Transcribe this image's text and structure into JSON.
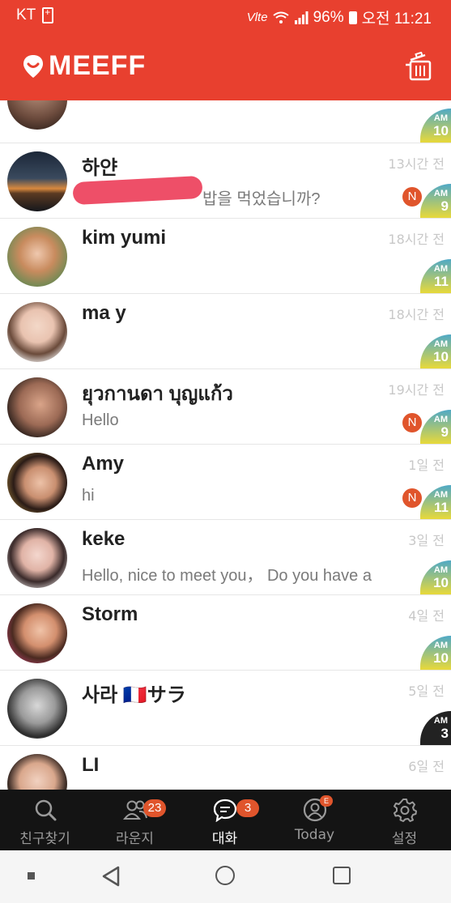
{
  "status": {
    "carrier": "KT",
    "network": "Vlte",
    "battery": "96%",
    "clock": "오전 11:21"
  },
  "header": {
    "brand": "MEEFF"
  },
  "chats": [
    {
      "name": "",
      "message": "",
      "time": "",
      "ampm": "AM",
      "hour": "10",
      "new": ""
    },
    {
      "name": "하얀",
      "message": "밥을 먹었습니까?",
      "time": "13시간 전",
      "ampm": "AM",
      "hour": "9",
      "new": "N"
    },
    {
      "name": "kim yumi",
      "message": "",
      "time": "18시간 전",
      "ampm": "AM",
      "hour": "11",
      "new": ""
    },
    {
      "name": "ma y",
      "message": "",
      "time": "18시간 전",
      "ampm": "AM",
      "hour": "10",
      "new": ""
    },
    {
      "name": "ยุวกานดา บุญแก้ว",
      "message": "Hello",
      "time": "19시간 전",
      "ampm": "AM",
      "hour": "9",
      "new": "N"
    },
    {
      "name": "Amy",
      "message": "hi",
      "time": "1일 전",
      "ampm": "AM",
      "hour": "11",
      "new": "N"
    },
    {
      "name": "keke",
      "message": "Hello, nice to meet you，  Do you have a",
      "time": "3일 전",
      "ampm": "AM",
      "hour": "10",
      "new": ""
    },
    {
      "name": "Storm",
      "message": "",
      "time": "4일 전",
      "ampm": "AM",
      "hour": "10",
      "new": ""
    },
    {
      "name": "사라 🇫🇷サラ",
      "message": "",
      "time": "5일 전",
      "ampm": "AM",
      "hour": "3",
      "new": ""
    },
    {
      "name": "LI",
      "message": "",
      "time": "6일 전",
      "ampm": "",
      "hour": "",
      "new": ""
    }
  ],
  "nav": {
    "find": {
      "label": "친구찾기"
    },
    "lounge": {
      "label": "라운지",
      "badge": "23"
    },
    "chat": {
      "label": "대화",
      "badge": "3"
    },
    "today": {
      "label": "Today",
      "badge": "E"
    },
    "settings": {
      "label": "설정"
    }
  },
  "colors": {
    "brand": "#e8402f",
    "badge": "#e0552c",
    "navbg": "#141414"
  }
}
